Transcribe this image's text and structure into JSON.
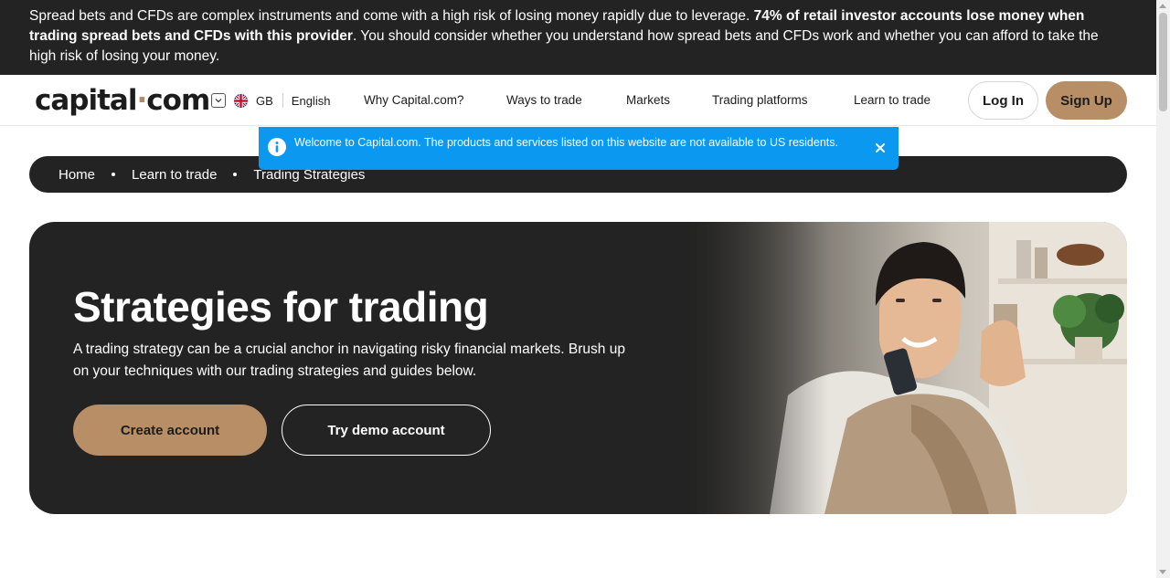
{
  "risk_warning": {
    "text_start": "Spread bets and CFDs are complex instruments and come with a high risk of losing money rapidly due to leverage. ",
    "text_bold": "74% of retail investor accounts lose money when trading spread bets and CFDs with this provider",
    "text_end": ". You should consider whether you understand how spread bets and CFDs work and whether you can afford to take the high risk of losing your money."
  },
  "header": {
    "logo_left": "capital",
    "logo_dot": "·",
    "logo_right": "com",
    "country": "GB",
    "language": "English",
    "nav": [
      "Why Capital.com?",
      "Ways to trade",
      "Markets",
      "Trading platforms",
      "Learn to trade"
    ],
    "login_label": "Log In",
    "signup_label": "Sign Up"
  },
  "notice": {
    "text": "Welcome to Capital.com. The products and services listed on this website are not available to US residents."
  },
  "breadcrumb": [
    "Home",
    "Learn to trade",
    "Trading Strategies"
  ],
  "hero": {
    "title": "Strategies for trading",
    "description": "A trading strategy can be a crucial anchor in navigating risky financial markets. Brush up on your techniques with our trading strategies and guides below.",
    "create_account_label": "Create account",
    "demo_account_label": "Try demo account"
  },
  "colors": {
    "dark": "#232323",
    "accent": "#b88e66",
    "notice_blue": "#0a98f0"
  }
}
